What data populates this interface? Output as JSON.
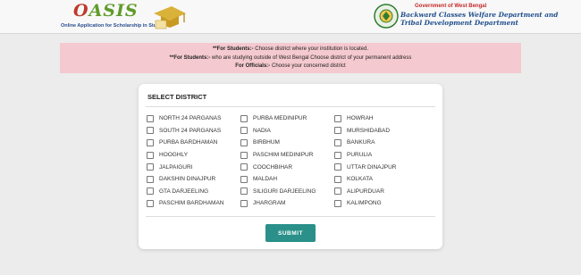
{
  "header": {
    "logo_word_first": "O",
    "logo_word_rest": "ASIS",
    "logo_tagline": "Online Application for Scholarship in Studies",
    "gov_line": "Government of West Bengal",
    "dept_line_1": "Backward Classes Welfare Department and",
    "dept_line_2": "Tribal Development Department"
  },
  "notice": {
    "line1_bold": "**For Students:-",
    "line1_text": " Choose district where your institution is located.",
    "line2_bold": "**For Students:-",
    "line2_text": " who are studying outside of West Bengal Choose district of your permanent address",
    "line3_bold": "For Officials:-",
    "line3_text": " Choose your concerned district"
  },
  "form": {
    "title": "SELECT DISTRICT",
    "submit_label": "SUBMIT",
    "districts": [
      "NORTH 24 PARGANAS",
      "PURBA MEDINIPUR",
      "HOWRAH",
      "SOUTH 24 PARGANAS",
      "NADIA",
      "MURSHIDABAD",
      "PURBA BARDHAMAN",
      "BIRBHUM",
      "BANKURA",
      "HOOGHLY",
      "PASCHIM MEDINIPUR",
      "PURULIA",
      "JALPAIGURI",
      "COOCHBIHAR",
      "UTTAR DINAJPUR",
      "DAKSHIN DINAJPUR",
      "MALDAH",
      "KOLKATA",
      "GTA DARJEELING",
      "SILIGURI DARJEELING",
      "ALIPURDUAR",
      "PASCHIM BARDHAMAN",
      "JHARGRAM",
      "KALIMPONG"
    ]
  },
  "colors": {
    "notice_bg": "#f4c9cf",
    "submit_bg": "#2a9089",
    "dept_text": "#1e4e8c",
    "gov_text": "#c62828"
  }
}
